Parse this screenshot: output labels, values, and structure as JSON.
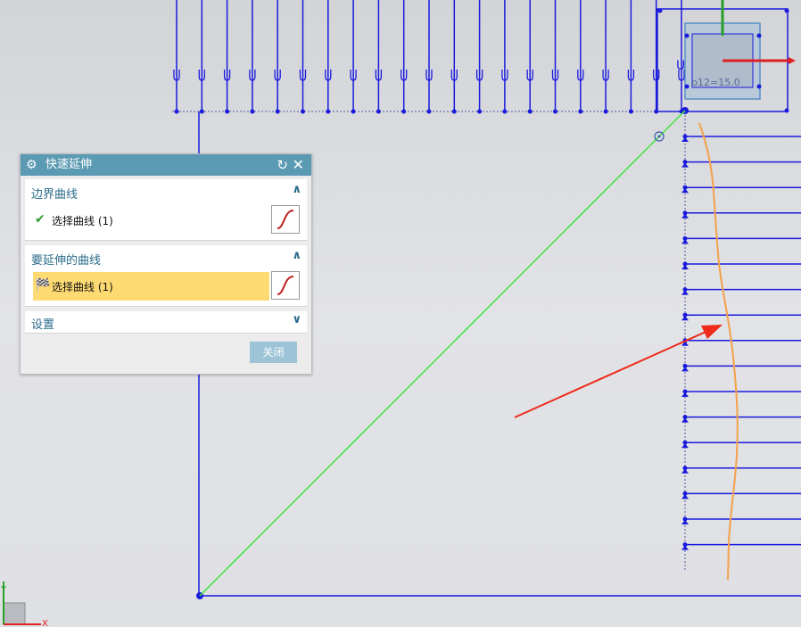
{
  "dialog": {
    "title": "快速延伸",
    "gear_icon": "gear-icon",
    "reset_icon": "reset-icon",
    "close_icon": "close-icon",
    "section1": {
      "header": "边界曲线",
      "item_label": "选择曲线 (1)",
      "status_icon": "check-icon"
    },
    "section2": {
      "header": "要延伸的曲线",
      "item_label": "选择曲线 (1)",
      "status_icon": "flag-icon"
    },
    "section3": {
      "header": "设置"
    },
    "close_button": "关闭"
  },
  "viewport": {
    "dimension_text": "p12=15.0",
    "axis_y": "Y",
    "axis_x": "X",
    "colors": {
      "geometry_blue": "#1a1adc",
      "diagonal_green": "#3ae63a",
      "sketch_orange": "#f4a04a",
      "arrow_red": "#ee2a1a",
      "highlight_box": "#a8c4dc"
    }
  }
}
